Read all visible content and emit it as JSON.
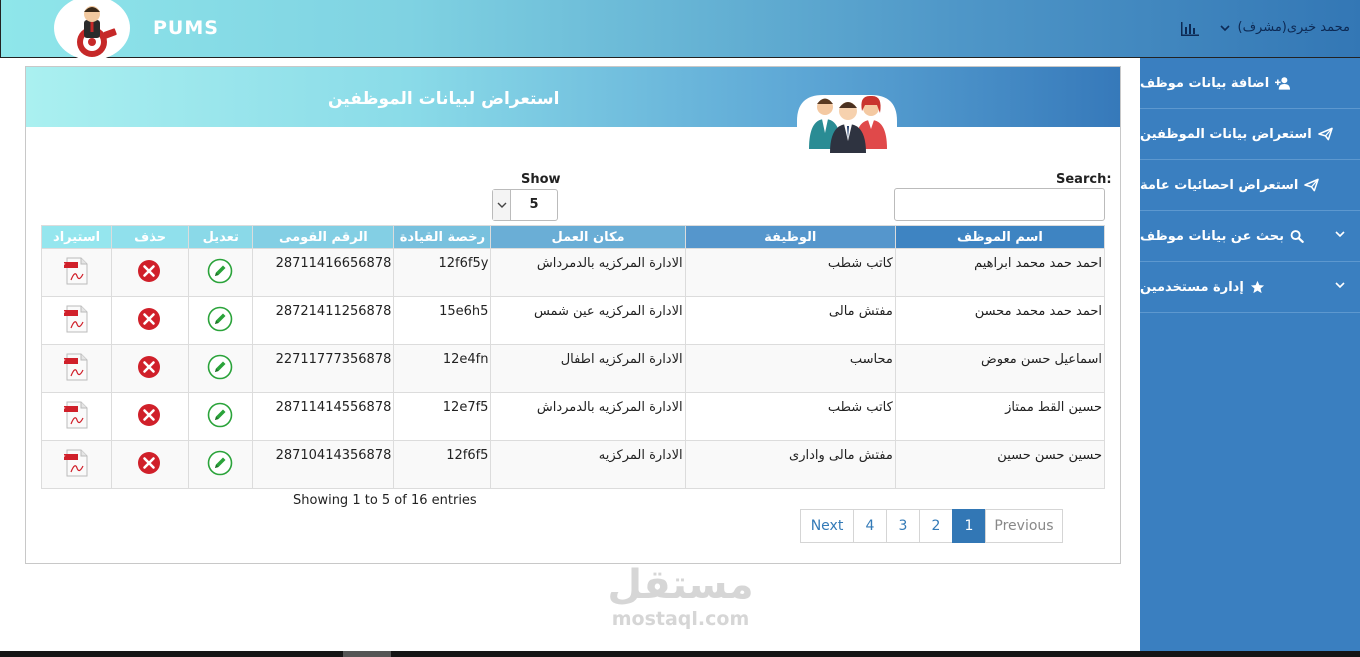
{
  "header": {
    "brand": "PUMS",
    "user_name": "محمد خيرى(مشرف)",
    "icons": [
      "logo-icon",
      "chevron-down-icon",
      "bar-chart-icon"
    ]
  },
  "sidebar": {
    "items": [
      {
        "label": "اضافة بيانات موظف",
        "icon": "user-plus-icon"
      },
      {
        "label": "استعراض بيانات الموظفين",
        "icon": "paper-plane-icon"
      },
      {
        "label": "استعراض احصائيات عامة",
        "icon": "paper-plane-icon"
      },
      {
        "label": "بحث عن بيانات موظف",
        "icon": "search-icon"
      },
      {
        "label": "إدارة مستخدمين",
        "icon": "star-icon"
      }
    ]
  },
  "panel": {
    "title": "استعراض لبيانات الموظفين",
    "search_label": "Search:",
    "search_value": "",
    "show_label": "Show",
    "show_value": "5"
  },
  "table": {
    "columns": [
      "اسم الموظف",
      "الوظيفة",
      "مكان العمل",
      "رخصة القيادة",
      "الرقم القومى",
      "تعديل",
      "حذف",
      "استيراد"
    ],
    "rows": [
      {
        "name": "احمد حمد محمد ابراهيم",
        "job": "كاتب شطب",
        "place": "الادارة المركزيه بالدمرداش",
        "license": "12f6f5y",
        "national_id": "28711416656878"
      },
      {
        "name": "احمد حمد محمد محسن",
        "job": "مفتش مالى",
        "place": "الادارة المركزيه عين شمس",
        "license": "15e6h5",
        "national_id": "28721411256878"
      },
      {
        "name": "اسماعيل حسن معوض",
        "job": "محاسب",
        "place": "الادارة المركزيه اطفال",
        "license": "12e4fn",
        "national_id": "22711777356878"
      },
      {
        "name": "حسين القط ممتاز",
        "job": "كاتب شطب",
        "place": "الادارة المركزيه بالدمرداش",
        "license": "12e7f5",
        "national_id": "28711414556878"
      },
      {
        "name": "حسين حسن حسين",
        "job": "مفتش مالى وادارى",
        "place": "الادارة المركزيه",
        "license": "12f6f5",
        "national_id": "28710414356878"
      }
    ]
  },
  "footer": {
    "showing": "Showing 1 to 5 of 16 entries",
    "pagination": {
      "previous": "Previous",
      "pages": [
        "1",
        "2",
        "3",
        "4"
      ],
      "active": "1",
      "next": "Next"
    }
  },
  "watermark": {
    "arabic": "مستقل",
    "latin": "mostaql.com"
  },
  "colors": {
    "sidebar": "#3a7fc0",
    "accent": "#3277b5",
    "delete_red": "#d0202a",
    "edit_green": "#2aa33a"
  }
}
